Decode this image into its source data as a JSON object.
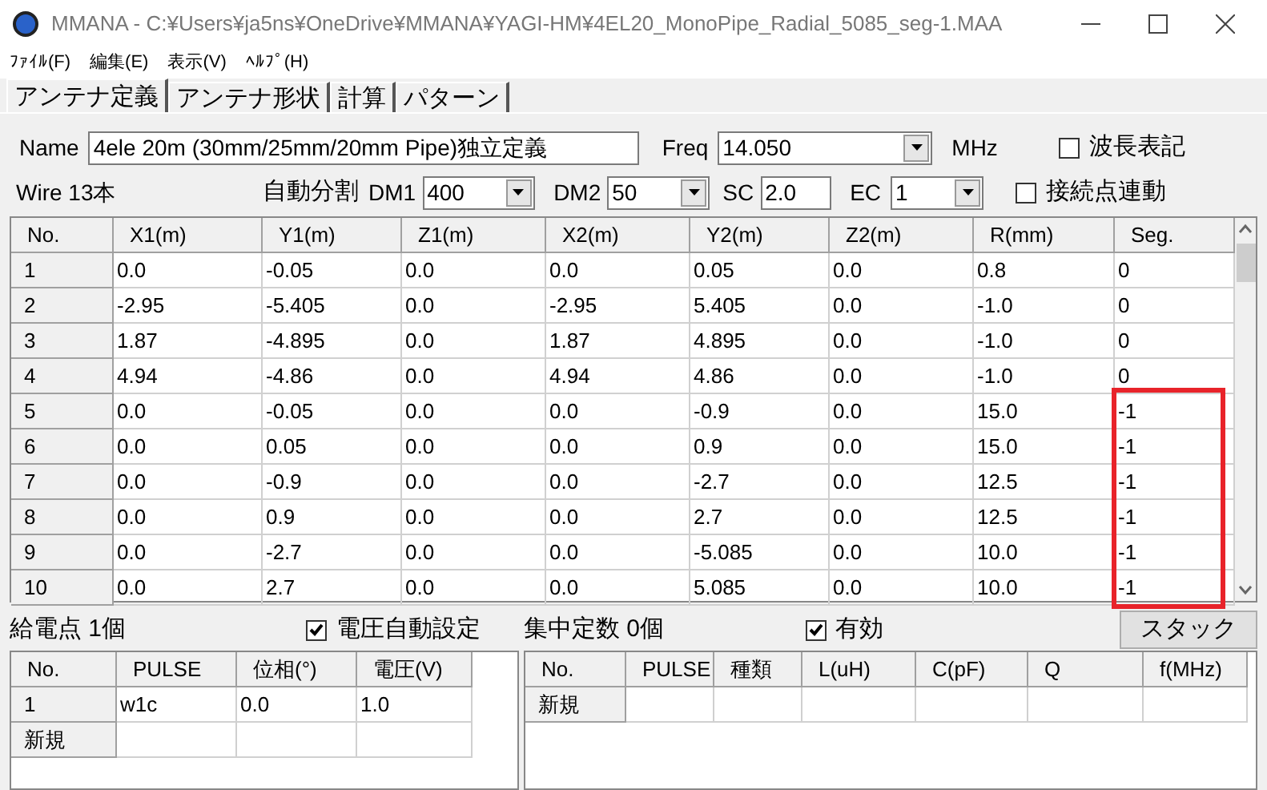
{
  "window": {
    "title": "MMANA - C:¥Users¥ja5ns¥OneDrive¥MMANA¥YAGI-HM¥4EL20_MonoPipe_Radial_5085_seg-1.MAA"
  },
  "menu": [
    "ﾌｧｲﾙ(F)",
    "編集(E)",
    "表示(V)",
    "ﾍﾙﾌﾟ(H)"
  ],
  "tabs": [
    {
      "label": "アンテナ定義",
      "selected": true
    },
    {
      "label": "アンテナ形状",
      "selected": false
    },
    {
      "label": "計算",
      "selected": false
    },
    {
      "label": "パターン",
      "selected": false
    }
  ],
  "name_label": "Name",
  "name_value": "4ele 20m (30mm/25mm/20mm Pipe)独立定義",
  "freq_label": "Freq",
  "freq_value": "14.050",
  "freq_unit": "MHz",
  "wavelength_option": {
    "label": "波長表記",
    "checked": false
  },
  "wire_count": "Wire 13本",
  "auto_split": "自動分割",
  "dm1": {
    "label": "DM1",
    "value": "400"
  },
  "dm2": {
    "label": "DM2",
    "value": "50"
  },
  "sc": {
    "label": "SC",
    "value": "2.0"
  },
  "ec": {
    "label": "EC",
    "value": "1"
  },
  "link_option": {
    "label": "接続点連動",
    "checked": false
  },
  "wires": {
    "columns": [
      "No.",
      "X1(m)",
      "Y1(m)",
      "Z1(m)",
      "X2(m)",
      "Y2(m)",
      "Z2(m)",
      "R(mm)",
      "Seg."
    ],
    "rows": [
      {
        "cells": [
          "1",
          "0.0",
          "-0.05",
          "0.0",
          "0.0",
          "0.05",
          "0.0",
          "0.8",
          "0"
        ],
        "highlighted": false
      },
      {
        "cells": [
          "2",
          "-2.95",
          "-5.405",
          "0.0",
          "-2.95",
          "5.405",
          "0.0",
          "-1.0",
          "0"
        ],
        "highlighted": false
      },
      {
        "cells": [
          "3",
          "1.87",
          "-4.895",
          "0.0",
          "1.87",
          "4.895",
          "0.0",
          "-1.0",
          "0"
        ],
        "highlighted": false
      },
      {
        "cells": [
          "4",
          "4.94",
          "-4.86",
          "0.0",
          "4.94",
          "4.86",
          "0.0",
          "-1.0",
          "0"
        ],
        "highlighted": false
      },
      {
        "cells": [
          "5",
          "0.0",
          "-0.05",
          "0.0",
          "0.0",
          "-0.9",
          "0.0",
          "15.0",
          "-1"
        ],
        "highlighted": true
      },
      {
        "cells": [
          "6",
          "0.0",
          "0.05",
          "0.0",
          "0.0",
          "0.9",
          "0.0",
          "15.0",
          "-1"
        ],
        "highlighted": true
      },
      {
        "cells": [
          "7",
          "0.0",
          "-0.9",
          "0.0",
          "0.0",
          "-2.7",
          "0.0",
          "12.5",
          "-1"
        ],
        "highlighted": true
      },
      {
        "cells": [
          "8",
          "0.0",
          "0.9",
          "0.0",
          "0.0",
          "2.7",
          "0.0",
          "12.5",
          "-1"
        ],
        "highlighted": true
      },
      {
        "cells": [
          "9",
          "0.0",
          "-2.7",
          "0.0",
          "0.0",
          "-5.085",
          "0.0",
          "10.0",
          "-1"
        ],
        "highlighted": true
      },
      {
        "cells": [
          "10",
          "0.0",
          "2.7",
          "0.0",
          "0.0",
          "5.085",
          "0.0",
          "10.0",
          "-1"
        ],
        "highlighted": true
      }
    ]
  },
  "feed": {
    "title": "給電点 1個",
    "auto_voltage": {
      "label": "電圧自動設定",
      "checked": true
    },
    "columns": [
      "No.",
      "PULSE",
      "位相(°)",
      "電圧(V)"
    ],
    "rows": [
      [
        "1",
        "w1c",
        "0.0",
        "1.0"
      ],
      [
        "新規",
        "",
        "",
        ""
      ]
    ]
  },
  "loads": {
    "title": "集中定数 0個",
    "enabled": {
      "label": "有効",
      "checked": true
    },
    "columns": [
      "No.",
      "PULSE",
      "種類",
      "L(uH)",
      "C(pF)",
      "Q",
      "f(MHz)"
    ],
    "rows": [
      [
        "新規",
        "",
        "",
        "",
        "",
        "",
        ""
      ]
    ]
  },
  "stack_button": "スタック"
}
